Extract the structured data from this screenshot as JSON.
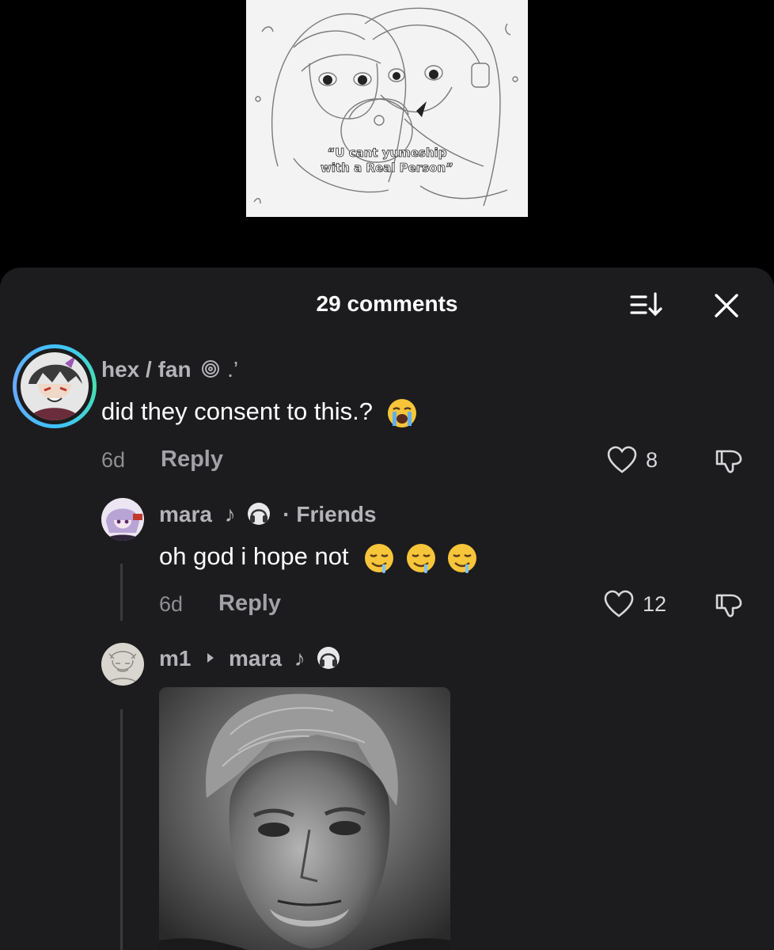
{
  "video": {
    "caption_line1": "“U cant yumeship",
    "caption_line2": "with a Real Person”"
  },
  "sheet": {
    "title": "29 comments",
    "sort_icon": "sort-icon",
    "close_icon": "close-icon"
  },
  "comments": [
    {
      "username": "hex / fan",
      "username_suffix": "@ .’",
      "text": "did they consent to this.?",
      "emoji": "loudly-crying-face",
      "age": "6d",
      "reply_label": "Reply",
      "likes": "8"
    },
    {
      "username": "mara",
      "username_suffix": "♪",
      "badge": "· Friends",
      "text": "oh god i hope not",
      "emoji": "drooling-face ×3",
      "age": "6d",
      "reply_label": "Reply",
      "likes": "12"
    },
    {
      "username": "m1",
      "reply_to": "mara",
      "reply_to_suffix": "♪"
    }
  ],
  "colors": {
    "background": "#000000",
    "sheet": "#1c1c1e",
    "username": "#b3b3b8",
    "meta": "#8e8e93",
    "avatar_ring": "#3fc1ff"
  }
}
